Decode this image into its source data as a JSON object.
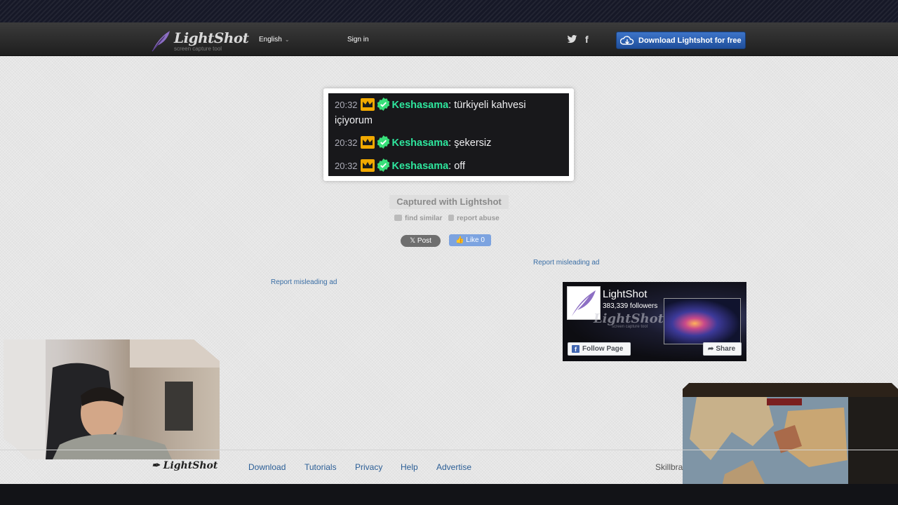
{
  "header": {
    "brand": "LightShot",
    "tagline": "screen capture tool",
    "language": "English",
    "sign_in": "Sign in",
    "download_button": "Download Lightshot for free",
    "social_icons": [
      "twitter-icon",
      "facebook-icon"
    ]
  },
  "screenshot": {
    "chat": [
      {
        "time": "20:32",
        "user": "Keshasama",
        "message": ": türkiyeli kahvesi",
        "wrap": "içiyorum"
      },
      {
        "time": "20:32",
        "user": "Keshasama",
        "message": ": şekersiz"
      },
      {
        "time": "20:32",
        "user": "Keshasama",
        "message": ": off"
      }
    ],
    "user_color": "#2ee59d"
  },
  "captured_label": "Captured with Lightshot",
  "actions": {
    "find_similar": "find similar",
    "report_abuse": "report abuse",
    "post": "Post",
    "like": "Like 0"
  },
  "ads": {
    "report_right": "Report misleading ad",
    "report_left": "Report misleading ad"
  },
  "fb_widget": {
    "page_name": "LightShot",
    "followers": "383,339 followers",
    "cover_brand": "LightShot",
    "cover_tagline": "screen capture tool",
    "follow": "Follow Page",
    "share": "Share"
  },
  "footer": {
    "logo": "LightShot",
    "links": [
      "Download",
      "Tutorials",
      "Privacy",
      "Help",
      "Advertise"
    ],
    "partial": "Skillbra"
  },
  "colors": {
    "accent_button": "#2d62b6",
    "link": "#2b5e96"
  }
}
